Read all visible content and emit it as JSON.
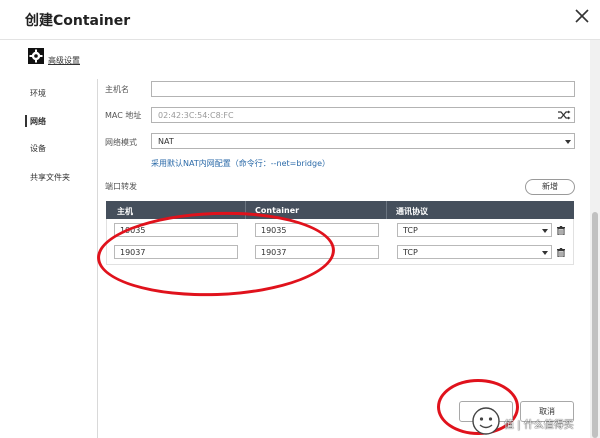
{
  "window": {
    "title": "创建Container"
  },
  "advanced": {
    "label": "高级设置"
  },
  "sidebar": {
    "items": [
      {
        "label": "环境"
      },
      {
        "label": "网络"
      },
      {
        "label": "设备"
      },
      {
        "label": "共享文件夹"
      }
    ],
    "active_index": 1
  },
  "form": {
    "hostname": {
      "label": "主机名",
      "value": ""
    },
    "mac": {
      "label": "MAC 地址",
      "value": "02:42:3C:54:C8:FC"
    },
    "network_mode": {
      "label": "网络模式",
      "value": "NAT"
    },
    "hint": "采用默认NAT内网配置（命令行：--net=bridge）"
  },
  "port_forwarding": {
    "label": "端口转发",
    "new_button": "新增",
    "columns": [
      "主机",
      "Container",
      "通讯协议"
    ],
    "rows": [
      {
        "host": "19035",
        "container": "19035",
        "protocol": "TCP"
      },
      {
        "host": "19037",
        "container": "19037",
        "protocol": "TCP"
      }
    ]
  },
  "footer": {
    "cancel_label": "取消"
  },
  "watermark": {
    "text": "值 | 什么值得买"
  },
  "icons": {
    "close": "close-icon",
    "gear": "gear-icon",
    "shuffle": "shuffle-icon",
    "trash": "trash-icon",
    "dropdown": "chevron-down-icon"
  },
  "colors": {
    "table_header": "#454f5c",
    "link": "#2b6aa8",
    "annotation": "#e0121c"
  }
}
